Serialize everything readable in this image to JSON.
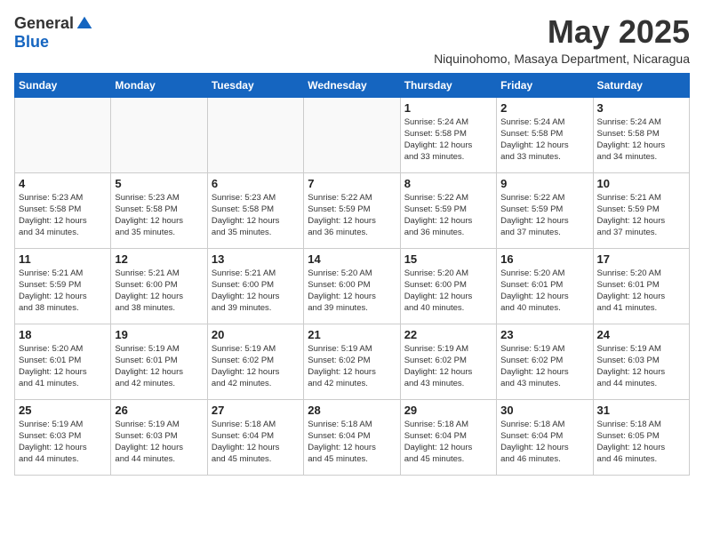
{
  "header": {
    "logo_general": "General",
    "logo_blue": "Blue",
    "month_title": "May 2025",
    "location": "Niquinohomo, Masaya Department, Nicaragua"
  },
  "days_of_week": [
    "Sunday",
    "Monday",
    "Tuesday",
    "Wednesday",
    "Thursday",
    "Friday",
    "Saturday"
  ],
  "weeks": [
    [
      {
        "day": "",
        "info": ""
      },
      {
        "day": "",
        "info": ""
      },
      {
        "day": "",
        "info": ""
      },
      {
        "day": "",
        "info": ""
      },
      {
        "day": "1",
        "info": "Sunrise: 5:24 AM\nSunset: 5:58 PM\nDaylight: 12 hours\nand 33 minutes."
      },
      {
        "day": "2",
        "info": "Sunrise: 5:24 AM\nSunset: 5:58 PM\nDaylight: 12 hours\nand 33 minutes."
      },
      {
        "day": "3",
        "info": "Sunrise: 5:24 AM\nSunset: 5:58 PM\nDaylight: 12 hours\nand 34 minutes."
      }
    ],
    [
      {
        "day": "4",
        "info": "Sunrise: 5:23 AM\nSunset: 5:58 PM\nDaylight: 12 hours\nand 34 minutes."
      },
      {
        "day": "5",
        "info": "Sunrise: 5:23 AM\nSunset: 5:58 PM\nDaylight: 12 hours\nand 35 minutes."
      },
      {
        "day": "6",
        "info": "Sunrise: 5:23 AM\nSunset: 5:58 PM\nDaylight: 12 hours\nand 35 minutes."
      },
      {
        "day": "7",
        "info": "Sunrise: 5:22 AM\nSunset: 5:59 PM\nDaylight: 12 hours\nand 36 minutes."
      },
      {
        "day": "8",
        "info": "Sunrise: 5:22 AM\nSunset: 5:59 PM\nDaylight: 12 hours\nand 36 minutes."
      },
      {
        "day": "9",
        "info": "Sunrise: 5:22 AM\nSunset: 5:59 PM\nDaylight: 12 hours\nand 37 minutes."
      },
      {
        "day": "10",
        "info": "Sunrise: 5:21 AM\nSunset: 5:59 PM\nDaylight: 12 hours\nand 37 minutes."
      }
    ],
    [
      {
        "day": "11",
        "info": "Sunrise: 5:21 AM\nSunset: 5:59 PM\nDaylight: 12 hours\nand 38 minutes."
      },
      {
        "day": "12",
        "info": "Sunrise: 5:21 AM\nSunset: 6:00 PM\nDaylight: 12 hours\nand 38 minutes."
      },
      {
        "day": "13",
        "info": "Sunrise: 5:21 AM\nSunset: 6:00 PM\nDaylight: 12 hours\nand 39 minutes."
      },
      {
        "day": "14",
        "info": "Sunrise: 5:20 AM\nSunset: 6:00 PM\nDaylight: 12 hours\nand 39 minutes."
      },
      {
        "day": "15",
        "info": "Sunrise: 5:20 AM\nSunset: 6:00 PM\nDaylight: 12 hours\nand 40 minutes."
      },
      {
        "day": "16",
        "info": "Sunrise: 5:20 AM\nSunset: 6:01 PM\nDaylight: 12 hours\nand 40 minutes."
      },
      {
        "day": "17",
        "info": "Sunrise: 5:20 AM\nSunset: 6:01 PM\nDaylight: 12 hours\nand 41 minutes."
      }
    ],
    [
      {
        "day": "18",
        "info": "Sunrise: 5:20 AM\nSunset: 6:01 PM\nDaylight: 12 hours\nand 41 minutes."
      },
      {
        "day": "19",
        "info": "Sunrise: 5:19 AM\nSunset: 6:01 PM\nDaylight: 12 hours\nand 42 minutes."
      },
      {
        "day": "20",
        "info": "Sunrise: 5:19 AM\nSunset: 6:02 PM\nDaylight: 12 hours\nand 42 minutes."
      },
      {
        "day": "21",
        "info": "Sunrise: 5:19 AM\nSunset: 6:02 PM\nDaylight: 12 hours\nand 42 minutes."
      },
      {
        "day": "22",
        "info": "Sunrise: 5:19 AM\nSunset: 6:02 PM\nDaylight: 12 hours\nand 43 minutes."
      },
      {
        "day": "23",
        "info": "Sunrise: 5:19 AM\nSunset: 6:02 PM\nDaylight: 12 hours\nand 43 minutes."
      },
      {
        "day": "24",
        "info": "Sunrise: 5:19 AM\nSunset: 6:03 PM\nDaylight: 12 hours\nand 44 minutes."
      }
    ],
    [
      {
        "day": "25",
        "info": "Sunrise: 5:19 AM\nSunset: 6:03 PM\nDaylight: 12 hours\nand 44 minutes."
      },
      {
        "day": "26",
        "info": "Sunrise: 5:19 AM\nSunset: 6:03 PM\nDaylight: 12 hours\nand 44 minutes."
      },
      {
        "day": "27",
        "info": "Sunrise: 5:18 AM\nSunset: 6:04 PM\nDaylight: 12 hours\nand 45 minutes."
      },
      {
        "day": "28",
        "info": "Sunrise: 5:18 AM\nSunset: 6:04 PM\nDaylight: 12 hours\nand 45 minutes."
      },
      {
        "day": "29",
        "info": "Sunrise: 5:18 AM\nSunset: 6:04 PM\nDaylight: 12 hours\nand 45 minutes."
      },
      {
        "day": "30",
        "info": "Sunrise: 5:18 AM\nSunset: 6:04 PM\nDaylight: 12 hours\nand 46 minutes."
      },
      {
        "day": "31",
        "info": "Sunrise: 5:18 AM\nSunset: 6:05 PM\nDaylight: 12 hours\nand 46 minutes."
      }
    ]
  ]
}
